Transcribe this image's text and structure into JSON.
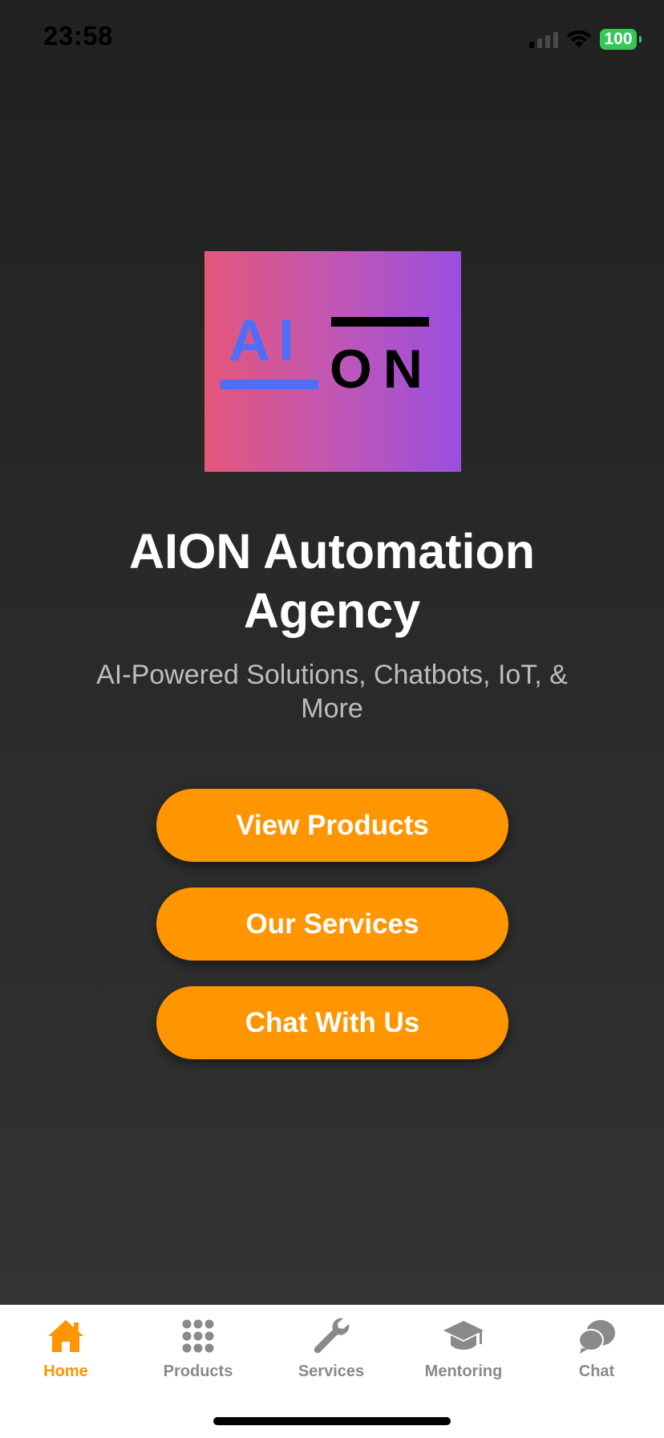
{
  "status_bar": {
    "time": "23:58",
    "battery": "100",
    "battery_color": "#34c759"
  },
  "logo": {
    "text_left": "AI",
    "text_right": "ON",
    "accent_color": "#4f6ef7"
  },
  "hero": {
    "title": "AION Automation Agency",
    "subtitle": "AI-Powered Solutions, Chatbots, IoT, & More"
  },
  "buttons": {
    "view_products": "View Products",
    "our_services": "Our Services",
    "chat_with_us": "Chat With Us",
    "color": "#ff9500"
  },
  "tab_bar": {
    "items": [
      {
        "label": "Home",
        "icon": "house-icon",
        "active": true
      },
      {
        "label": "Products",
        "icon": "grid-icon",
        "active": false
      },
      {
        "label": "Services",
        "icon": "wrench-icon",
        "active": false
      },
      {
        "label": "Mentoring",
        "icon": "graduation-cap-icon",
        "active": false
      },
      {
        "label": "Chat",
        "icon": "chat-bubbles-icon",
        "active": false
      }
    ],
    "active_color": "#ff9500",
    "inactive_color": "#8a8a8a"
  }
}
